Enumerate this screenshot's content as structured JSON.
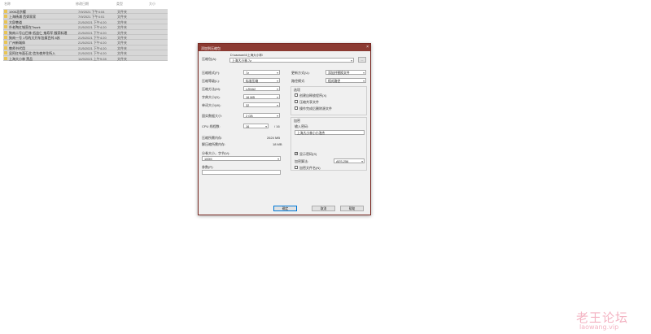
{
  "explorer": {
    "columns": [
      "名称",
      "修改日期",
      "类型",
      "大小"
    ],
    "rows": [
      {
        "name": "1905北京樱",
        "date": "7/9/2021 下午4:04",
        "type": "文件夹"
      },
      {
        "name": "上海杨浦 西郊家家",
        "date": "7/9/2021 下午4:01",
        "type": "文件夹"
      },
      {
        "name": "大邱巷道",
        "date": "21/5/2021 下午4:20",
        "type": "文件夹"
      },
      {
        "name": "扑老陶红城家在Twork",
        "date": "21/5/2021 下午4:20",
        "type": "文件夹"
      },
      {
        "name": "狗肉二号山巴林 低益仁 鬼寿军 服家料理",
        "date": "21/5/2021 下午4:20",
        "type": "文件夹"
      },
      {
        "name": "狗肉一号 1号的大开车包搞百舛 8苏",
        "date": "21/5/2021 下午4:20",
        "type": "文件夹"
      },
      {
        "name": "广州新城休",
        "date": "21/5/2021 下午4:20",
        "type": "文件夹"
      },
      {
        "name": "教师书代用",
        "date": "21/5/2021 下午4:20",
        "type": "文件夹"
      },
      {
        "name": "吴阿红布面石北 信东夜并住所入",
        "date": "21/5/2021 下午4:20",
        "type": "文件夹"
      },
      {
        "name": "上海大小林 黑品",
        "date": "14/9/2021 上午9:28",
        "type": "文件夹"
      }
    ]
  },
  "dialog": {
    "title": "添加到压缩包",
    "close": "×",
    "archive_name_label": "压缩包(A):",
    "archive_path": "D:\\caowan\\4\\上海大小林\\",
    "archive_name": "上海大小林.7z",
    "browse": "...",
    "format_label": "压缩格式(F):",
    "format_value": "7z",
    "level_label": "压缩等级(L):",
    "level_value": "标准压缩",
    "method_label": "压缩方法(M):",
    "method_value": "LZMA2",
    "dict_label": "字典大小(D):",
    "dict_value": "16 MB",
    "word_label": "单词大小(W):",
    "word_value": "32",
    "solid_label": "固实数据大小:",
    "solid_value": "2 GB",
    "cpu_label": "CPU 线程数:",
    "cpu_value": "16",
    "cpu_max": "/ 16",
    "mem_comp_label": "压缩所需内存:",
    "mem_comp_value": "2624 MB",
    "mem_decomp_label": "解压缩所需内存:",
    "mem_decomp_value": "18 MB",
    "split_label": "分卷大小，字节(V):",
    "split_value": "100M",
    "params_label": "参数(P):",
    "params_value": "",
    "update_label": "更新方式(U):",
    "update_value": "添加并替换文件",
    "path_label": "路径模式:",
    "path_value": "相对路径",
    "options_title": "选项",
    "opt_sfx": "创建自释放程序(X)",
    "opt_shared": "压缩共享文件",
    "opt_delete": "操作完成后删除源文件",
    "encrypt_title": "加密",
    "pwd_label": "输入密码:",
    "pwd_value": "上海大小林小小泡杰",
    "show_pwd": "显示密码(S)",
    "enc_method_label": "加密算法:",
    "enc_method_value": "AES-256",
    "enc_names": "加密文件名(N)",
    "ok": "确定",
    "cancel": "取消",
    "help": "帮助"
  },
  "watermark": {
    "zh": "老王论坛",
    "en": "laowang.vip"
  }
}
